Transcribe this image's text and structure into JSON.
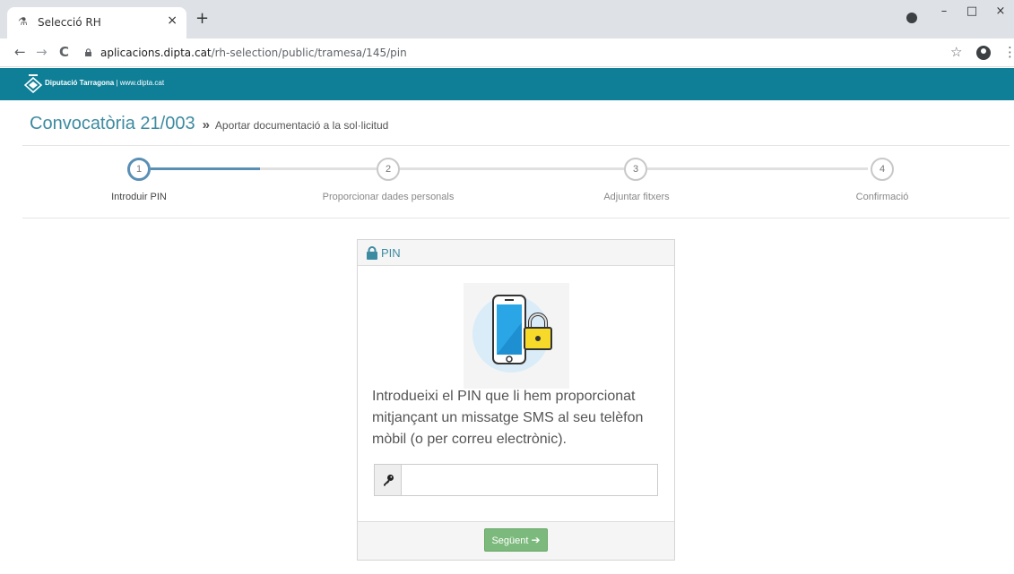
{
  "browser": {
    "tab_title": "Selecció RH",
    "tab_favicon": "⚗",
    "tab_close": "×",
    "new_tab": "+",
    "url_host": "aplicacions.dipta.cat",
    "url_path": "/rh-selection/public/tramesa/145/pin",
    "window_controls": {
      "minimize": "–",
      "maximize": "□",
      "close": "×"
    },
    "nav": {
      "back": "←",
      "forward": "→",
      "reload": "C"
    },
    "bookmark_star": "☆",
    "menu": "⋮"
  },
  "site": {
    "brand": "Diputació Tarragona",
    "separator": "|",
    "website": "www.dipta.cat"
  },
  "page": {
    "title": "Convocatòria 21/003",
    "breadcrumb_sep": "»",
    "subtitle": "Aportar documentació a la sol·licitud"
  },
  "steps": [
    {
      "number": "1",
      "label": "Introduir PIN",
      "active": true
    },
    {
      "number": "2",
      "label": "Proporcionar dades personals",
      "active": false
    },
    {
      "number": "3",
      "label": "Adjuntar fitxers",
      "active": false
    },
    {
      "number": "4",
      "label": "Confirmació",
      "active": false
    }
  ],
  "panel": {
    "title": "PIN",
    "instructions": "Introdueixi el PIN que li hem proporcionat mitjançant un missatge SMS al seu telèfon mòbil (o per correu electrònic).",
    "pin_value": "",
    "next_label": "Següent",
    "next_arrow": "➔"
  },
  "colors": {
    "header_bg": "#0f7f97",
    "accent": "#3d8ba1",
    "step_active": "#5a8fb5",
    "button_green": "#7cb97c"
  },
  "icons": {
    "tab": "flask-icon",
    "lock": "lock-icon",
    "key": "key-icon",
    "illustration": "phone-padlock-icon"
  }
}
